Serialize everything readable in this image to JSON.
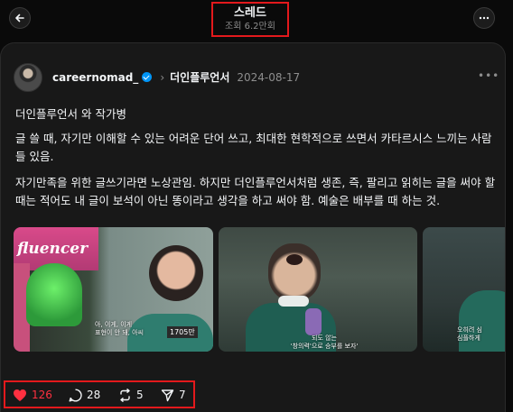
{
  "topbar": {
    "title": "스레드",
    "views": "조회 6.2만회"
  },
  "post": {
    "username": "careernomad_",
    "topic": "더인플루언서",
    "date": "2024-08-17",
    "paragraphs": [
      "더인플루언서 와 작가병",
      "글 쓸 때, 자기만 이해할 수 있는 어려운 단어 쓰고, 최대한 현학적으로 쓰면서 카타르시스 느끼는 사람들 있음.",
      "자기만족을 위한 글쓰기라면 노상관임. 하지만 더인플루언서처럼 생존, 즉, 팔리고 읽히는 글을 써야 할 때는 적어도 내 글이 보석이 아닌 똥이라고 생각을 하고 써야 함. 예술은 배부를 때 하는 것."
    ],
    "media": [
      {
        "sign_text": "fluencer",
        "badge_text": "1705만",
        "subtitle": "아, 이게, 이게\n표현이 안 돼, 아씨"
      },
      {
        "subtitle": "되도 않는\n'창의력'으로 승부를 보자'"
      },
      {
        "subtitle": "오히려 심\n심플하게"
      }
    ],
    "stats": {
      "likes": "126",
      "comments": "28",
      "reposts": "5",
      "shares": "7"
    }
  },
  "colors": {
    "background": "#0a0a0a",
    "card": "#181818",
    "like": "#ff3040",
    "highlight_box": "#e3191c",
    "verified": "#0095f6"
  },
  "icons": [
    "back-arrow-icon",
    "more-icon",
    "verified-badge-icon",
    "chevron-right-icon",
    "heart-icon",
    "comment-icon",
    "repost-icon",
    "share-icon"
  ]
}
